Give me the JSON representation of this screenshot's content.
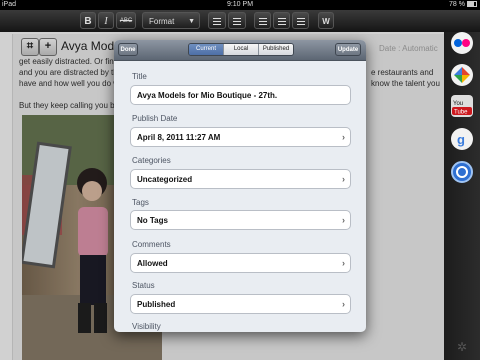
{
  "status_bar": {
    "carrier": "iPad",
    "time": "9:10 PM",
    "battery": "78 %"
  },
  "toolbar": {
    "bold": "B",
    "italic": "I",
    "strike": "ABC",
    "format": "Format",
    "more": "W"
  },
  "editor": {
    "post_title": "Avya Models",
    "date_label": "Date : Automatic",
    "text_line_1": "get easily distracted. Or finally",
    "text_line_2": "and you are distracted by the poss",
    "text_line_3": "have and how well you do wha",
    "text_line_4": "But they keep calling you back",
    "text_right_1": "e restaurants and",
    "text_right_2": "know the talent you"
  },
  "popover": {
    "done_label": "Done",
    "update_label": "Update",
    "segments": [
      "Current",
      "Local",
      "Published"
    ],
    "selected_segment": "Current",
    "title_label": "Title",
    "title_value": "Avya Models for Mio Boutique - 27th.",
    "publish_date_label": "Publish Date",
    "publish_date_value": "April 8, 2011 11:27 AM",
    "categories_label": "Categories",
    "categories_value": "Uncategorized",
    "tags_label": "Tags",
    "tags_value": "No Tags",
    "comments_label": "Comments",
    "comments_value": "Allowed",
    "status_label": "Status",
    "status_value": "Published",
    "visibility_label": "Visibility"
  },
  "sidebar_icons": [
    "flickr-icon",
    "picasa-icon",
    "youtube-icon",
    "google-icon",
    "web-icon",
    "settings-icon"
  ],
  "colors": {
    "accent": "#4d6fa6",
    "popover_bar": "#6d7682"
  }
}
